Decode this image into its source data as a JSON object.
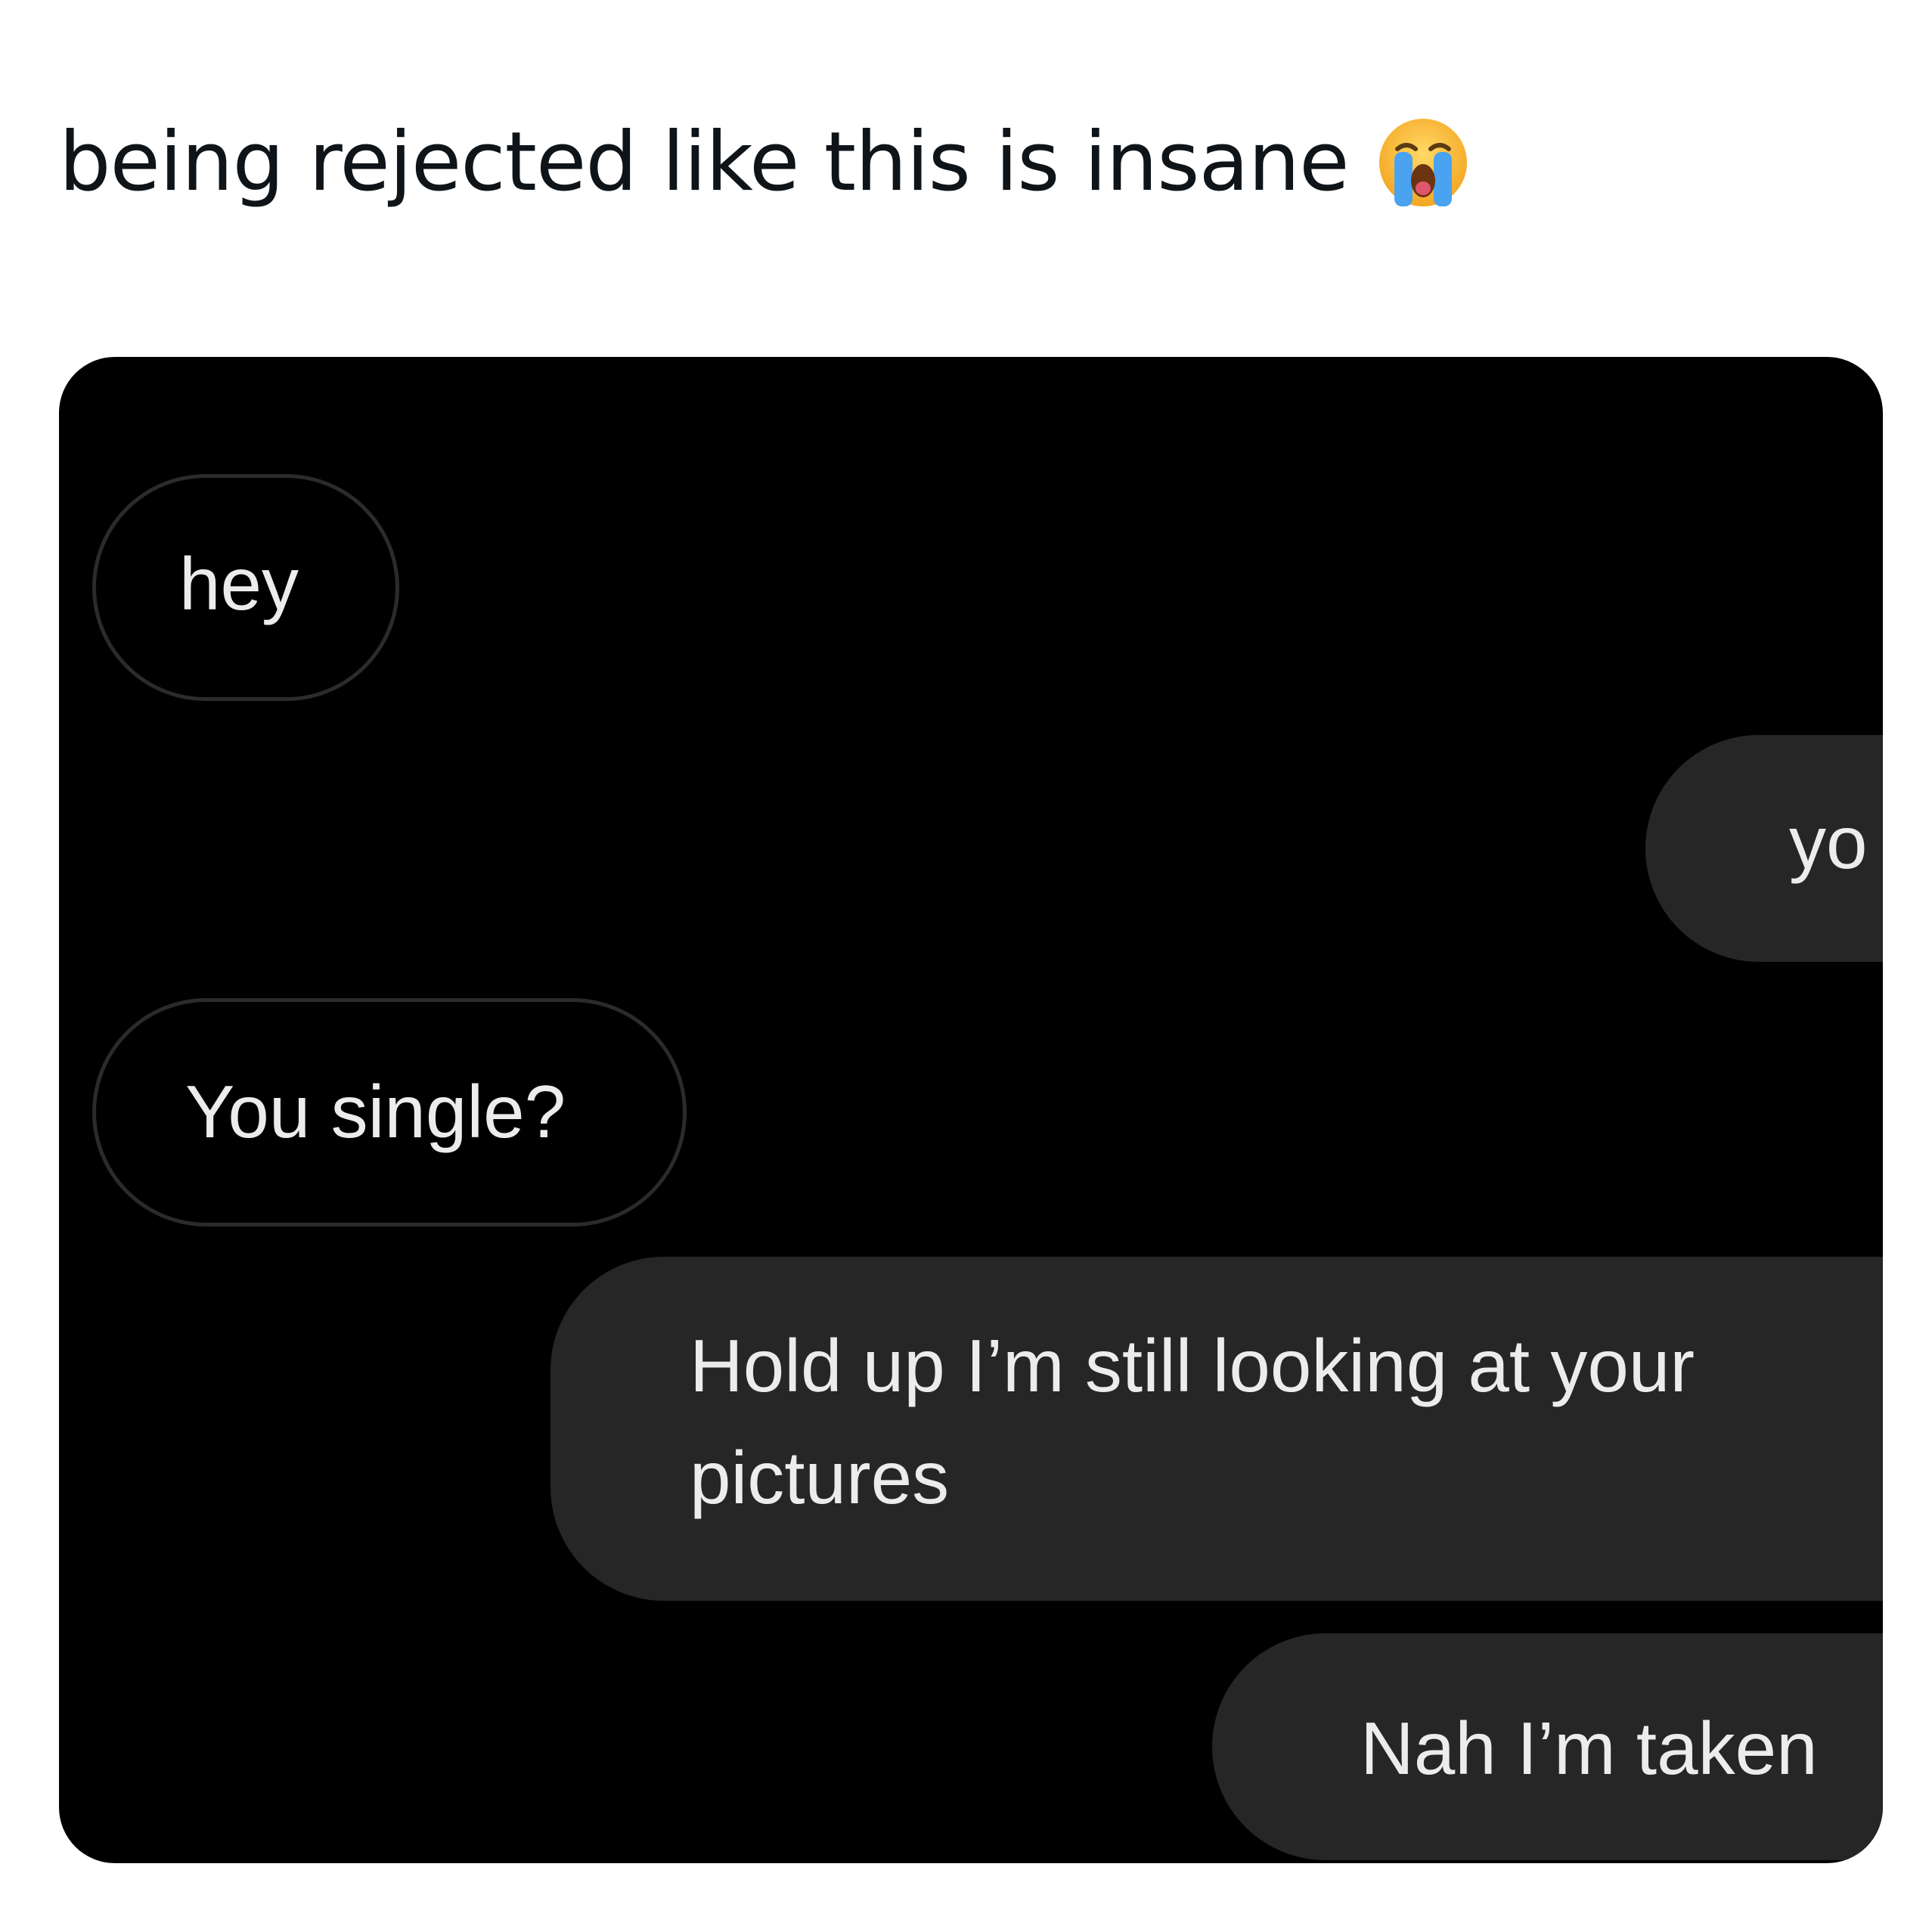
{
  "post": {
    "text": "being rejected like this is insane",
    "emoji": "loudly-crying-face-icon"
  },
  "chat": {
    "messages": [
      {
        "sender": "them",
        "text": "hey"
      },
      {
        "sender": "me",
        "text": "yo"
      },
      {
        "sender": "them",
        "text": "You single?"
      },
      {
        "sender": "me",
        "text": "Hold up I’m still looking at your pictures"
      },
      {
        "sender": "me",
        "text": "Nah I’m taken"
      }
    ]
  },
  "colors": {
    "background": "#ffffff",
    "text": "#0f1419",
    "screenshot_background": "#000000",
    "outgoing_bubble": "#262626",
    "incoming_bubble_border": "#2b2b2b",
    "bubble_text": "#ececec"
  }
}
